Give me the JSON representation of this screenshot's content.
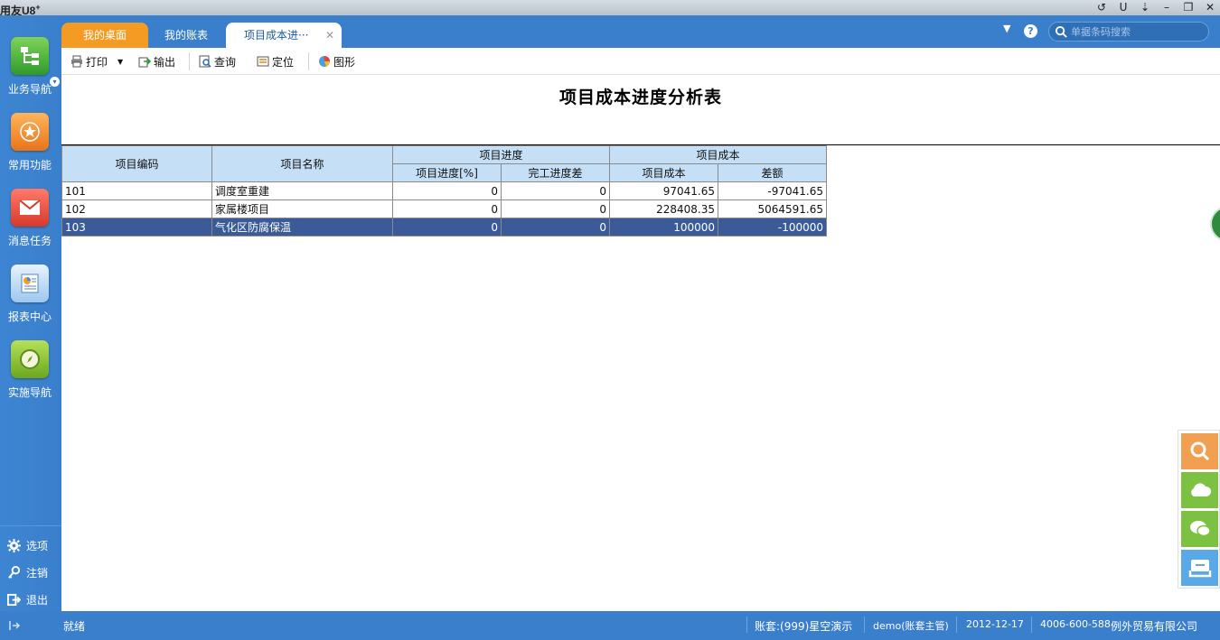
{
  "app": {
    "logo_text": "用友U8",
    "logo_sup": "+"
  },
  "window_controls": [
    "↺",
    "U",
    "⇣",
    "–",
    "❐",
    "✕"
  ],
  "sidebar": {
    "items": [
      {
        "label": "业务导航",
        "icon": "org-chart-icon",
        "color": "#3fae3a"
      },
      {
        "label": "常用功能",
        "icon": "star-icon",
        "color": "#f08a24"
      },
      {
        "label": "消息任务",
        "icon": "envelope-icon",
        "color": "#e24a3a"
      },
      {
        "label": "报表中心",
        "icon": "report-icon",
        "color": "#4f9be0"
      },
      {
        "label": "实施导航",
        "icon": "compass-icon",
        "color": "#7dba2e"
      }
    ],
    "bottom": [
      {
        "label": "选项",
        "icon": "gear-icon"
      },
      {
        "label": "注销",
        "icon": "key-icon"
      },
      {
        "label": "退出",
        "icon": "exit-icon"
      }
    ]
  },
  "tabs": [
    {
      "label": "我的桌面"
    },
    {
      "label": "我的账表"
    },
    {
      "label": "项目成本进···",
      "active": true
    }
  ],
  "search": {
    "placeholder": "单据条码搜索"
  },
  "toolbar": {
    "print": "打印",
    "export": "输出",
    "query": "查询",
    "locate": "定位",
    "chart": "图形"
  },
  "report": {
    "title": "项目成本进度分析表",
    "headers": {
      "code": "项目编码",
      "name": "项目名称",
      "progress_group": "项目进度",
      "cost_group": "项目成本",
      "progress_pct": "项目进度[%]",
      "completion_diff": "完工进度差",
      "cost": "项目成本",
      "diff": "差额"
    },
    "rows": [
      {
        "code": "101",
        "name": "调度室重建",
        "progress": "0",
        "completion": "0",
        "cost": "97041.65",
        "diff": "-97041.65"
      },
      {
        "code": "102",
        "name": "家属楼项目",
        "progress": "0",
        "completion": "0",
        "cost": "228408.35",
        "diff": "5064591.65"
      },
      {
        "code": "103",
        "name": "气化区防腐保温",
        "progress": "0",
        "completion": "0",
        "cost": "100000",
        "diff": "-100000"
      }
    ]
  },
  "status": {
    "ready": "就绪",
    "account": "账套:(999)星空演示",
    "user": "demo(账套主管)",
    "date": "2012-12-17",
    "phone": "4006-600-588",
    "company": "例外贸易有限公司"
  },
  "colors": {
    "primary_blue": "#3a7fcb",
    "tab_orange": "#f59a23",
    "header_blue": "#c5dff7",
    "selected_row": "#3b5b98"
  }
}
